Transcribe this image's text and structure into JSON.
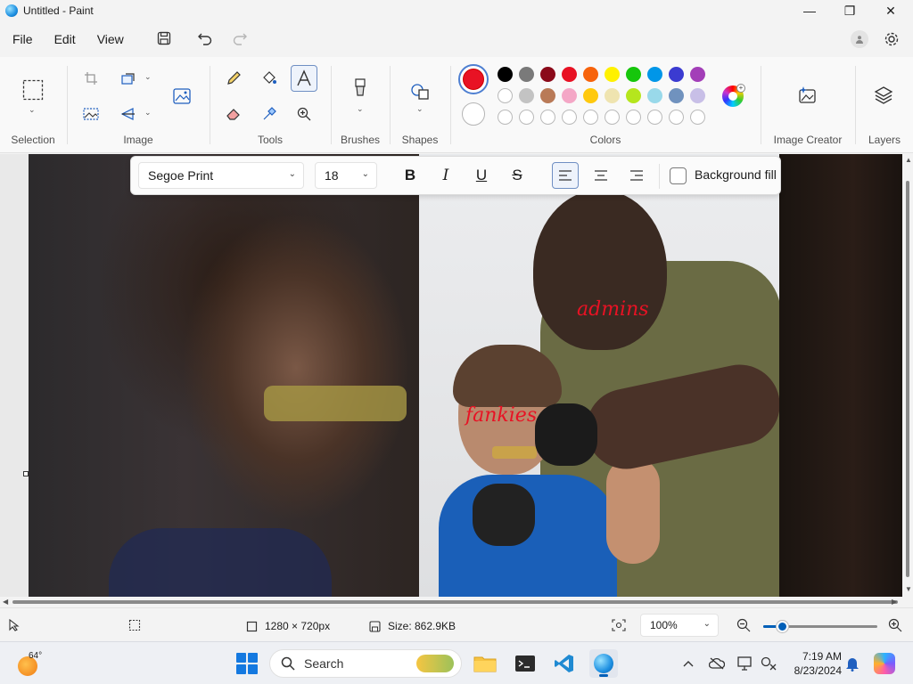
{
  "window": {
    "title": "Untitled - Paint",
    "minimize": "—",
    "maximize": "❐",
    "close": "✕"
  },
  "menu": {
    "file": "File",
    "edit": "Edit",
    "view": "View"
  },
  "ribbon": {
    "groups": {
      "selection": "Selection",
      "image": "Image",
      "tools": "Tools",
      "brushes": "Brushes",
      "shapes": "Shapes",
      "colors": "Colors",
      "image_creator": "Image Creator",
      "layers": "Layers"
    },
    "colors": {
      "primary": "#e81224",
      "secondary": "#ffffff",
      "row1": [
        "#000000",
        "#7a7a7a",
        "#8b0a1a",
        "#e81224",
        "#f7630c",
        "#fff100",
        "#16c60c",
        "#0096e8",
        "#3b3bd1",
        "#a33fb8"
      ],
      "row2": [
        "#ffffff",
        "#c3c3c3",
        "#b97a57",
        "#f4a7c6",
        "#ffc90e",
        "#efe4b0",
        "#b5e61d",
        "#99d9ea",
        "#7092be",
        "#c8bfe7"
      ]
    }
  },
  "text_toolbar": {
    "font": "Segoe Print",
    "size": "18",
    "bold": "B",
    "italic": "I",
    "underline": "U",
    "strike": "S",
    "background_fill": "Background fill"
  },
  "canvas": {
    "labels": {
      "admins": "admins",
      "fankies": "fankies"
    }
  },
  "status": {
    "dimensions": "1280 × 720px",
    "size": "Size: 862.9KB",
    "zoom": "100%",
    "zoom_level": 0.17
  },
  "taskbar": {
    "temperature": "64°",
    "search": "Search",
    "time": "7:19 AM",
    "date": "8/23/2024"
  }
}
